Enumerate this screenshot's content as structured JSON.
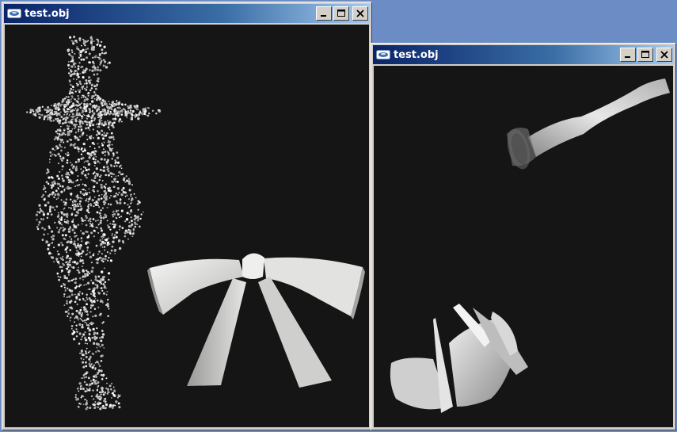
{
  "windows": [
    {
      "title": "test.obj",
      "state": "active",
      "buttons": {
        "minimize_icon": "minimize-icon",
        "maximize_icon": "maximize-icon",
        "close_icon": "close-icon"
      },
      "viewport": {
        "background": "#151515",
        "objects": [
          "point-cloud-figure",
          "white-bow-mesh"
        ]
      }
    },
    {
      "title": "test.obj",
      "state": "inactive",
      "buttons": {
        "minimize_icon": "minimize-icon",
        "maximize_icon": "maximize-icon",
        "close_icon": "close-icon"
      },
      "viewport": {
        "background": "#151515",
        "objects": [
          "leg-mesh",
          "skirt-mesh"
        ]
      }
    }
  ],
  "colors": {
    "desktop": "#6b8cc4",
    "titlebar_start": "#0a246a",
    "titlebar_end": "#a6caf0",
    "viewport": "#151515"
  }
}
